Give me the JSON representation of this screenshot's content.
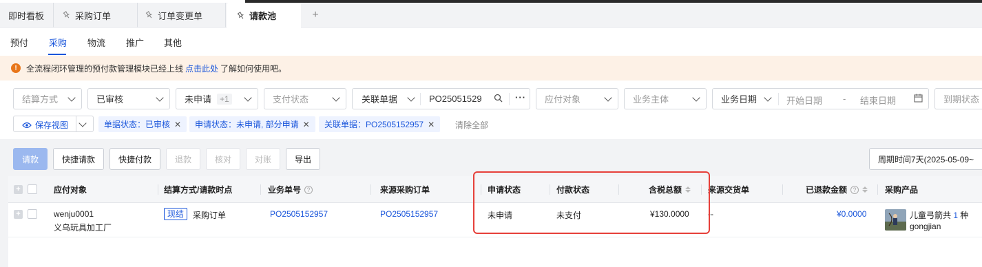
{
  "window_tabs": [
    {
      "label": "即时看板"
    },
    {
      "label": "采购订单"
    },
    {
      "label": "订单变更单"
    },
    {
      "label": "请款池"
    }
  ],
  "subnav": [
    "预付",
    "采购",
    "物流",
    "推广",
    "其他"
  ],
  "banner": {
    "text_before": "全流程闭环管理的预付款管理模块已经上线",
    "link": "点击此处",
    "text_after": "了解如何使用吧。"
  },
  "filters": {
    "settle_method": "结算方式",
    "doc_status": "已审核",
    "apply_status": "未申请",
    "apply_status_extra": "+1",
    "pay_status": "支付状态",
    "related_doc": "关联单据",
    "related_value": "PO25051529",
    "payee": "应付对象",
    "business_entity": "业务主体",
    "business_date": "业务日期",
    "start_date": "开始日期",
    "date_sep": "-",
    "end_date": "结束日期",
    "due_status": "到期状态"
  },
  "save_view": "保存视图",
  "chips": [
    "单据状态：已审核",
    "申请状态：未申请, 部分申请",
    "关联单据：PO2505152957"
  ],
  "clear_all": "清除全部",
  "actions": {
    "request": "请款",
    "quick_request": "快捷请款",
    "quick_pay": "快捷付款",
    "refund": "退款",
    "verify": "核对",
    "reconcile": "对账",
    "export": "导出"
  },
  "period": "周期时间7天(2025-05-09~",
  "table": {
    "headers": {
      "payee": "应付对象",
      "settle": "结算方式/请款时点",
      "biz_no": "业务单号",
      "source_po": "来源采购订单",
      "apply_status": "申请状态",
      "pay_status": "付款状态",
      "total": "含税总额",
      "source_delivery": "来源交货单",
      "refunded": "已退款金额",
      "product": "采购产品"
    },
    "rows": [
      {
        "payee_id": "wenju0001",
        "payee_name": "义乌玩具加工厂",
        "settle_badge": "现结",
        "settle_point": "采购订单",
        "biz_no": "PO2505152957",
        "source_po": "PO2505152957",
        "apply_status": "未申请",
        "pay_status": "未支付",
        "total": "¥130.0000",
        "source_delivery": "--",
        "refunded": "¥0.0000",
        "product_text": "儿童弓箭共",
        "product_count": "1",
        "product_unit": "种",
        "product_sku": "gongjian"
      }
    ]
  },
  "colors": {
    "accent": "#1a56db",
    "highlight": "#e6403a",
    "banner_bg": "#fdf1e6",
    "warning": "#e8761a"
  }
}
